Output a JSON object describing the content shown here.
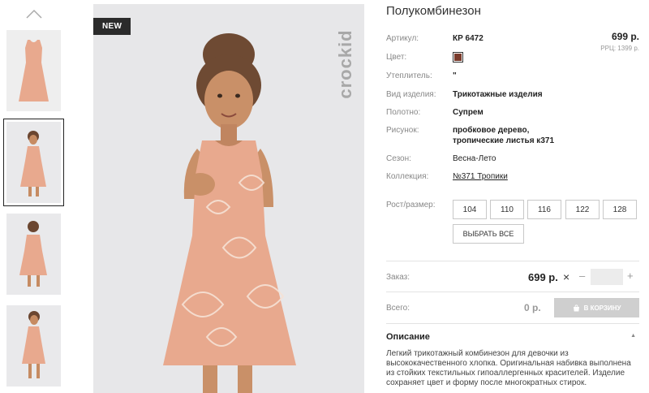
{
  "gallery": {
    "thumbnails": [
      {
        "view": "dress-flat"
      },
      {
        "view": "girl-front",
        "active": true
      },
      {
        "view": "girl-back"
      },
      {
        "view": "girl-side"
      }
    ],
    "badge": "NEW",
    "brand": "crockid"
  },
  "product": {
    "title": "Полукомбинезон",
    "price": "699 р.",
    "rrp": "РРЦ: 1399 р.",
    "color_hex": "#7a3b2c",
    "attributes": {
      "article": {
        "label": "Артикул:",
        "value": "КР 6472"
      },
      "color": {
        "label": "Цвет:"
      },
      "insulation": {
        "label": "Утеплитель:",
        "value": "\""
      },
      "type": {
        "label": "Вид изделия:",
        "value": "Трикотажные изделия"
      },
      "fabric": {
        "label": "Полотно:",
        "value": "Супрем"
      },
      "pattern": {
        "label": "Рисунок:",
        "value_line1": "пробковое дерево,",
        "value_line2": "тропические листья к371"
      },
      "season": {
        "label": "Сезон:",
        "value": "Весна-Лето"
      },
      "collection": {
        "label": "Коллекция:",
        "value": "№371 Тропики"
      }
    },
    "sizes": {
      "label": "Рост/размер:",
      "options": [
        "104",
        "110",
        "116",
        "122",
        "128"
      ],
      "select_all": "ВЫБРАТЬ ВСЕ"
    }
  },
  "order": {
    "label": "Заказ:",
    "price": "699 р.",
    "times": "×",
    "minus": "–",
    "plus": "+",
    "quantity": ""
  },
  "total": {
    "label": "Всего:",
    "value": "0 р.",
    "cart_button": "В КОРЗИНУ"
  },
  "description": {
    "title": "Описание",
    "caret": "▲",
    "text": "Легкий трикотажный комбинезон для девочки из высококачественного хлопка. Оригинальная набивка выполнена из стойких текстильных гипоаллергенных красителей. Изделие сохраняет цвет и форму после многократных стирок."
  },
  "colors": {
    "accent_dark": "#2b2b2b",
    "dress_peach": "#e8a98e",
    "photo_bg": "#e7e7e9",
    "button_disabled": "#cfcfcf"
  }
}
